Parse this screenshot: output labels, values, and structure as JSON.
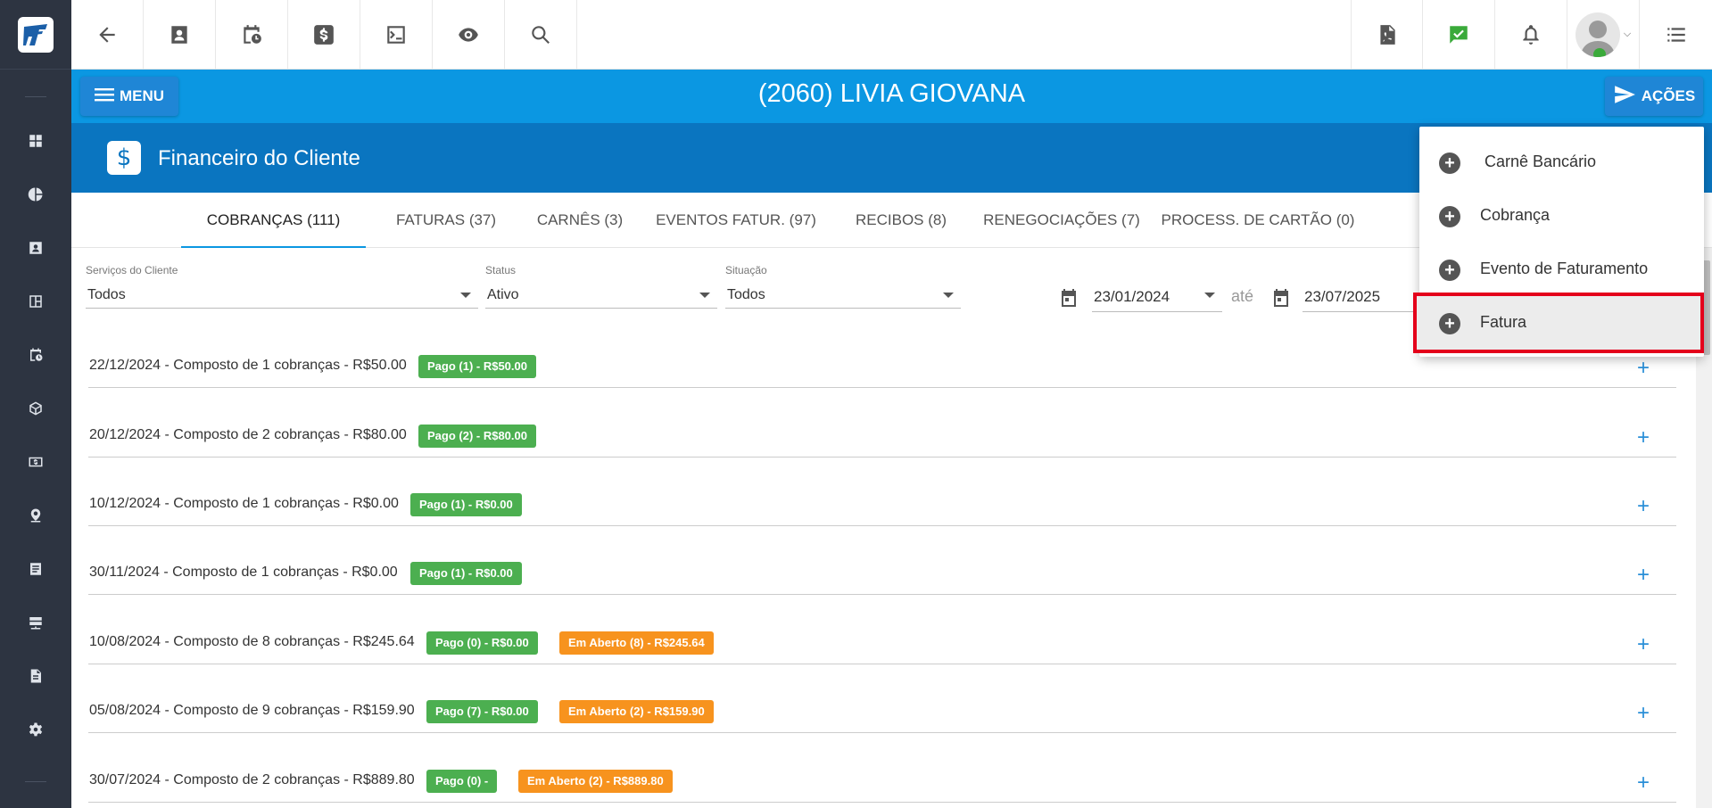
{
  "client_title": "(2060) LIVIA GIOVANA",
  "menu_label": "MENU",
  "acoes_label": "AÇÕES",
  "section_title": "Financeiro do Cliente",
  "section_icon": "$",
  "tabs": [
    {
      "label": "COBRANÇAS (111)"
    },
    {
      "label": "FATURAS (37)"
    },
    {
      "label": "CARNÊS (3)"
    },
    {
      "label": "EVENTOS FATUR. (97)"
    },
    {
      "label": "RECIBOS (8)"
    },
    {
      "label": "RENEGOCIAÇÕES (7)"
    },
    {
      "label": "PROCESS. DE CARTÃO (0)"
    }
  ],
  "filters": {
    "servicos": {
      "label": "Serviços do Cliente",
      "value": "Todos"
    },
    "status": {
      "label": "Status",
      "value": "Ativo"
    },
    "situacao": {
      "label": "Situação",
      "value": "Todos"
    },
    "date_from": "23/01/2024",
    "date_sep": "até",
    "date_to": "23/07/2025"
  },
  "rows": [
    {
      "text": "22/12/2024 - Composto de 1 cobranças - R$50.00",
      "badges": [
        {
          "label": "Pago (1) - R$50.00",
          "color": "green"
        }
      ]
    },
    {
      "text": "20/12/2024 - Composto de 2 cobranças - R$80.00",
      "badges": [
        {
          "label": "Pago (2) - R$80.00",
          "color": "green"
        }
      ]
    },
    {
      "text": "10/12/2024 - Composto de 1 cobranças - R$0.00",
      "badges": [
        {
          "label": "Pago (1) - R$0.00",
          "color": "green"
        }
      ]
    },
    {
      "text": "30/11/2024 - Composto de 1 cobranças - R$0.00",
      "badges": [
        {
          "label": "Pago (1) - R$0.00",
          "color": "green"
        }
      ]
    },
    {
      "text": "10/08/2024 - Composto de 8 cobranças - R$245.64",
      "badges": [
        {
          "label": "Pago (0) - R$0.00",
          "color": "green"
        },
        {
          "label": "Em Aberto (8) - R$245.64",
          "color": "orange"
        }
      ]
    },
    {
      "text": "05/08/2024 - Composto de 9 cobranças - R$159.90",
      "badges": [
        {
          "label": "Pago (7) - R$0.00",
          "color": "green"
        },
        {
          "label": "Em Aberto (2) - R$159.90",
          "color": "orange"
        }
      ]
    },
    {
      "text": "30/07/2024 - Composto de 2 cobranças - R$889.80",
      "badges": [
        {
          "label": "Pago (0) -",
          "color": "green"
        },
        {
          "label": "Em Aberto (2) - R$889.80",
          "color": "orange"
        }
      ]
    }
  ],
  "dropdown": {
    "items": [
      {
        "label": "Carnê Bancário"
      },
      {
        "label": "Cobrança"
      },
      {
        "label": "Evento de Faturamento"
      },
      {
        "label": "Fatura"
      }
    ]
  },
  "colors": {
    "sidebar": "#2d3441",
    "header_blue": "#0b97e2",
    "section_blue": "#0a75c0",
    "badge_green": "#4caf50",
    "badge_orange": "#f7931e",
    "highlight_red": "#e4001b"
  }
}
